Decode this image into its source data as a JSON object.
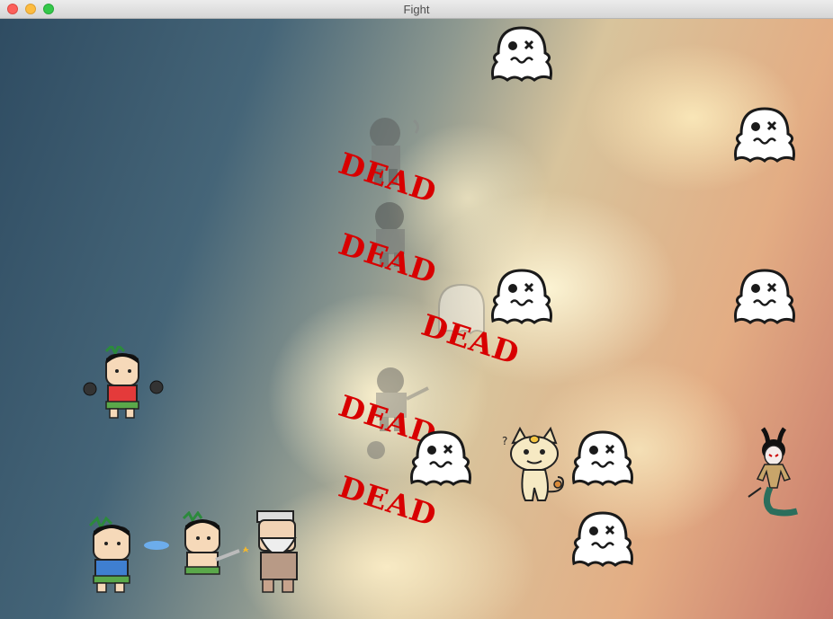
{
  "window": {
    "title": "Fight"
  },
  "game": {
    "dead_label": "DEAD",
    "heroes": [
      "hero-bomber",
      "hero-water",
      "hero-sword",
      "elder"
    ],
    "enemies": [
      "ghost",
      "ghost",
      "ghost",
      "ghost",
      "ghost",
      "ghost",
      "ghost",
      "meowth",
      "snake-demon"
    ],
    "defeated_count": 5
  }
}
